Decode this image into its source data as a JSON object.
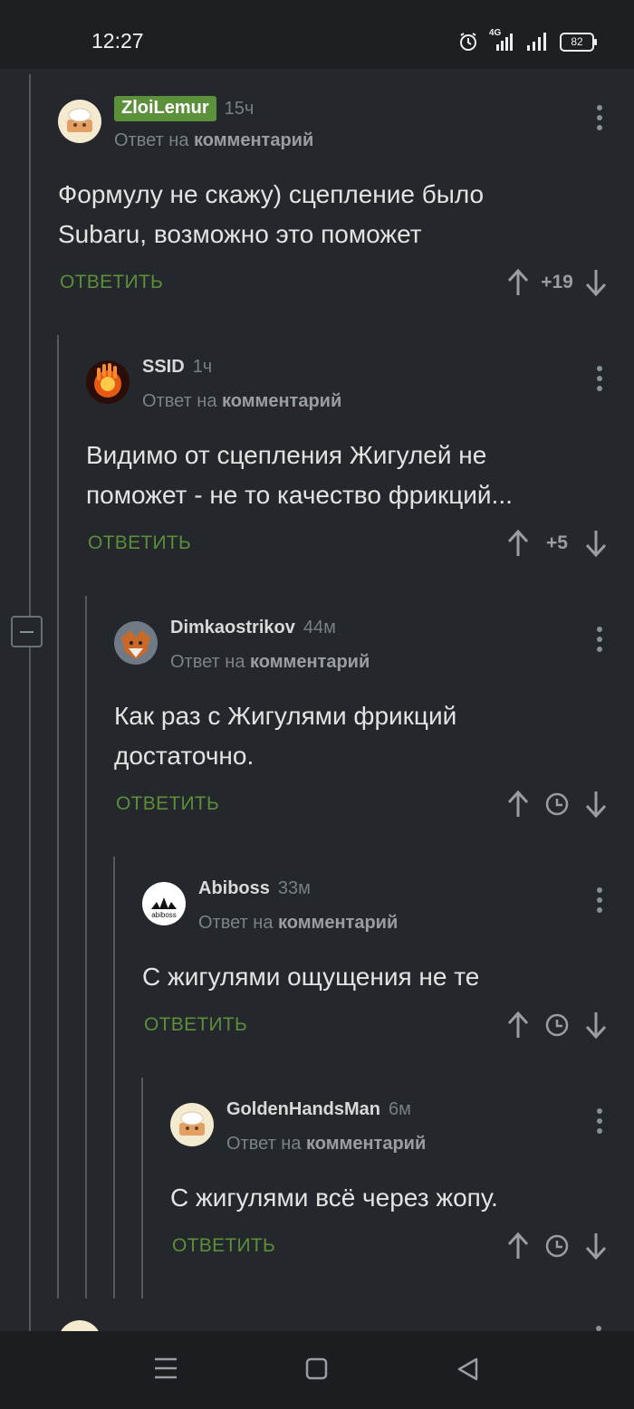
{
  "status_bar": {
    "time": "12:27",
    "network": "4G",
    "battery": "82"
  },
  "comments": [
    {
      "author": "ZloiLemur",
      "age": "15ч",
      "reply_prefix": "Ответ на",
      "reply_target": "комментарий",
      "text_lines": [
        "Формулу не скажу) сцепление было",
        "Subaru, возможно это поможет"
      ],
      "reply_label": "ОТВЕТИТЬ",
      "score": "+19"
    },
    {
      "author": "SSID",
      "age": "1ч",
      "reply_prefix": "Ответ на",
      "reply_target": "комментарий",
      "text_lines": [
        "Видимо от сцепления Жигулей не",
        "поможет - не то качество фрикций..."
      ],
      "reply_label": "ОТВЕТИТЬ",
      "score": "+5"
    },
    {
      "author": "Dimkaostrikov",
      "age": "44м",
      "reply_prefix": "Ответ на",
      "reply_target": "комментарий",
      "text_lines": [
        "Как раз с Жигулями фрикций",
        "достаточно."
      ],
      "reply_label": "ОТВЕТИТЬ",
      "score": ""
    },
    {
      "author": "Abiboss",
      "age": "33м",
      "reply_prefix": "Ответ на",
      "reply_target": "комментарий",
      "text_lines": [
        "С жигулями ощущения не те"
      ],
      "reply_label": "ОТВЕТИТЬ",
      "score": "",
      "avatar_text": "abiboss"
    },
    {
      "author": "GoldenHandsMan",
      "age": "6м",
      "reply_prefix": "Ответ на",
      "reply_target": "комментарий",
      "text_lines": [
        "С жигулями всё через жопу."
      ],
      "reply_label": "ОТВЕТИТЬ",
      "score": ""
    }
  ],
  "colors": {
    "background": "#24272b",
    "accent_green": "#5b8f3a",
    "author_highlight": "#5c913b"
  }
}
